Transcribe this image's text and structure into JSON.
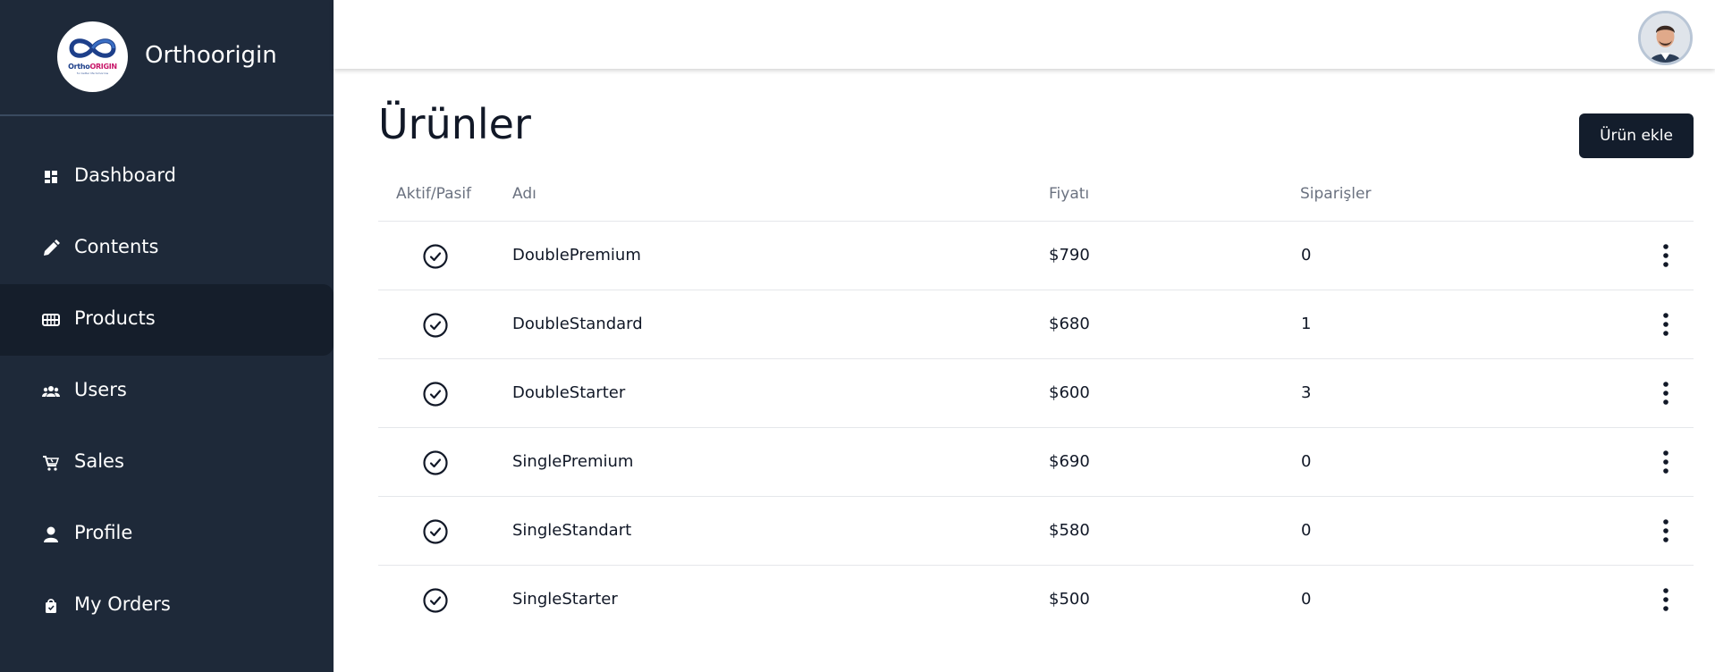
{
  "brand": {
    "name": "Orthoorigin",
    "logo_text_1": "Ortho",
    "logo_text_2": "ORIGIN",
    "logo_sub": "for better life tomorrow"
  },
  "sidebar": {
    "items": [
      {
        "label": "Dashboard",
        "icon": "dashboard-icon",
        "active": false
      },
      {
        "label": "Contents",
        "icon": "pencil-icon",
        "active": false
      },
      {
        "label": "Products",
        "icon": "products-icon",
        "active": true
      },
      {
        "label": "Users",
        "icon": "users-icon",
        "active": false
      },
      {
        "label": "Sales",
        "icon": "cart-icon",
        "active": false
      },
      {
        "label": "Profile",
        "icon": "person-icon",
        "active": false
      },
      {
        "label": "My Orders",
        "icon": "bag-icon",
        "active": false
      }
    ]
  },
  "main": {
    "title": "Ürünler",
    "add_button": "Ürün ekle",
    "columns": {
      "status": "Aktif/Pasif",
      "name": "Adı",
      "price": "Fiyatı",
      "orders": "Siparişler"
    },
    "rows": [
      {
        "name": "DoublePremium",
        "price": "$790",
        "orders": "0"
      },
      {
        "name": "DoubleStandard",
        "price": "$680",
        "orders": "1"
      },
      {
        "name": "DoubleStarter",
        "price": "$600",
        "orders": "3"
      },
      {
        "name": "SinglePremium",
        "price": "$690",
        "orders": "0"
      },
      {
        "name": "SingleStandart",
        "price": "$580",
        "orders": "0"
      },
      {
        "name": "SingleStarter",
        "price": "$500",
        "orders": "0"
      }
    ]
  },
  "colors": {
    "sidebar_bg": "#1e2939",
    "sidebar_active_bg": "#151e2b",
    "button_bg": "#131d2c"
  }
}
